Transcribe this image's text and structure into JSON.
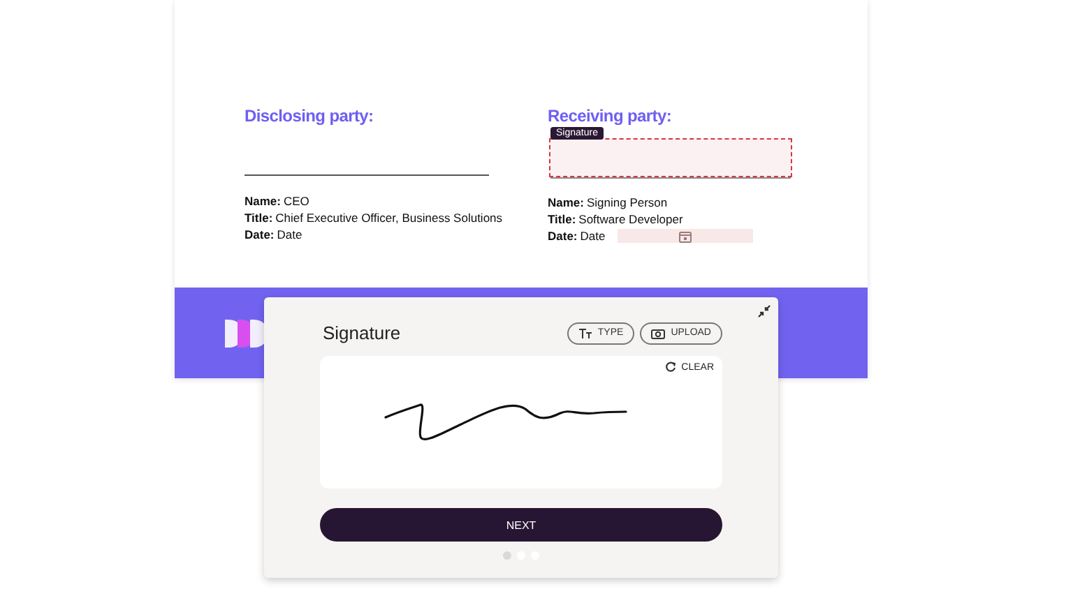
{
  "document": {
    "parties": [
      {
        "heading": "Disclosing party:",
        "signature_field": false,
        "fields": [
          {
            "label": "Name:",
            "value": "CEO",
            "date_input": false
          },
          {
            "label": "Title:",
            "value": "Chief Executive Officer, Business Solutions",
            "date_input": false
          },
          {
            "label": "Date:",
            "value": "Date",
            "date_input": false
          }
        ]
      },
      {
        "heading": "Receiving party:",
        "signature_field": true,
        "tooltip": "Signature",
        "fields": [
          {
            "label": "Name:",
            "value": "Signing Person",
            "date_input": false
          },
          {
            "label": "Title:",
            "value": "Software Developer",
            "date_input": false
          },
          {
            "label": "Date:",
            "value": "Date",
            "date_input": true
          }
        ]
      }
    ]
  },
  "signature_dialog": {
    "title": "Signature",
    "actions": [
      {
        "label": "TYPE",
        "kind": "type"
      },
      {
        "label": "UPLOAD",
        "kind": "upload"
      }
    ],
    "clear_label": "CLEAR",
    "next_label": "NEXT",
    "steps": [
      {
        "selected": true
      },
      {
        "selected": false
      },
      {
        "selected": false
      }
    ]
  }
}
